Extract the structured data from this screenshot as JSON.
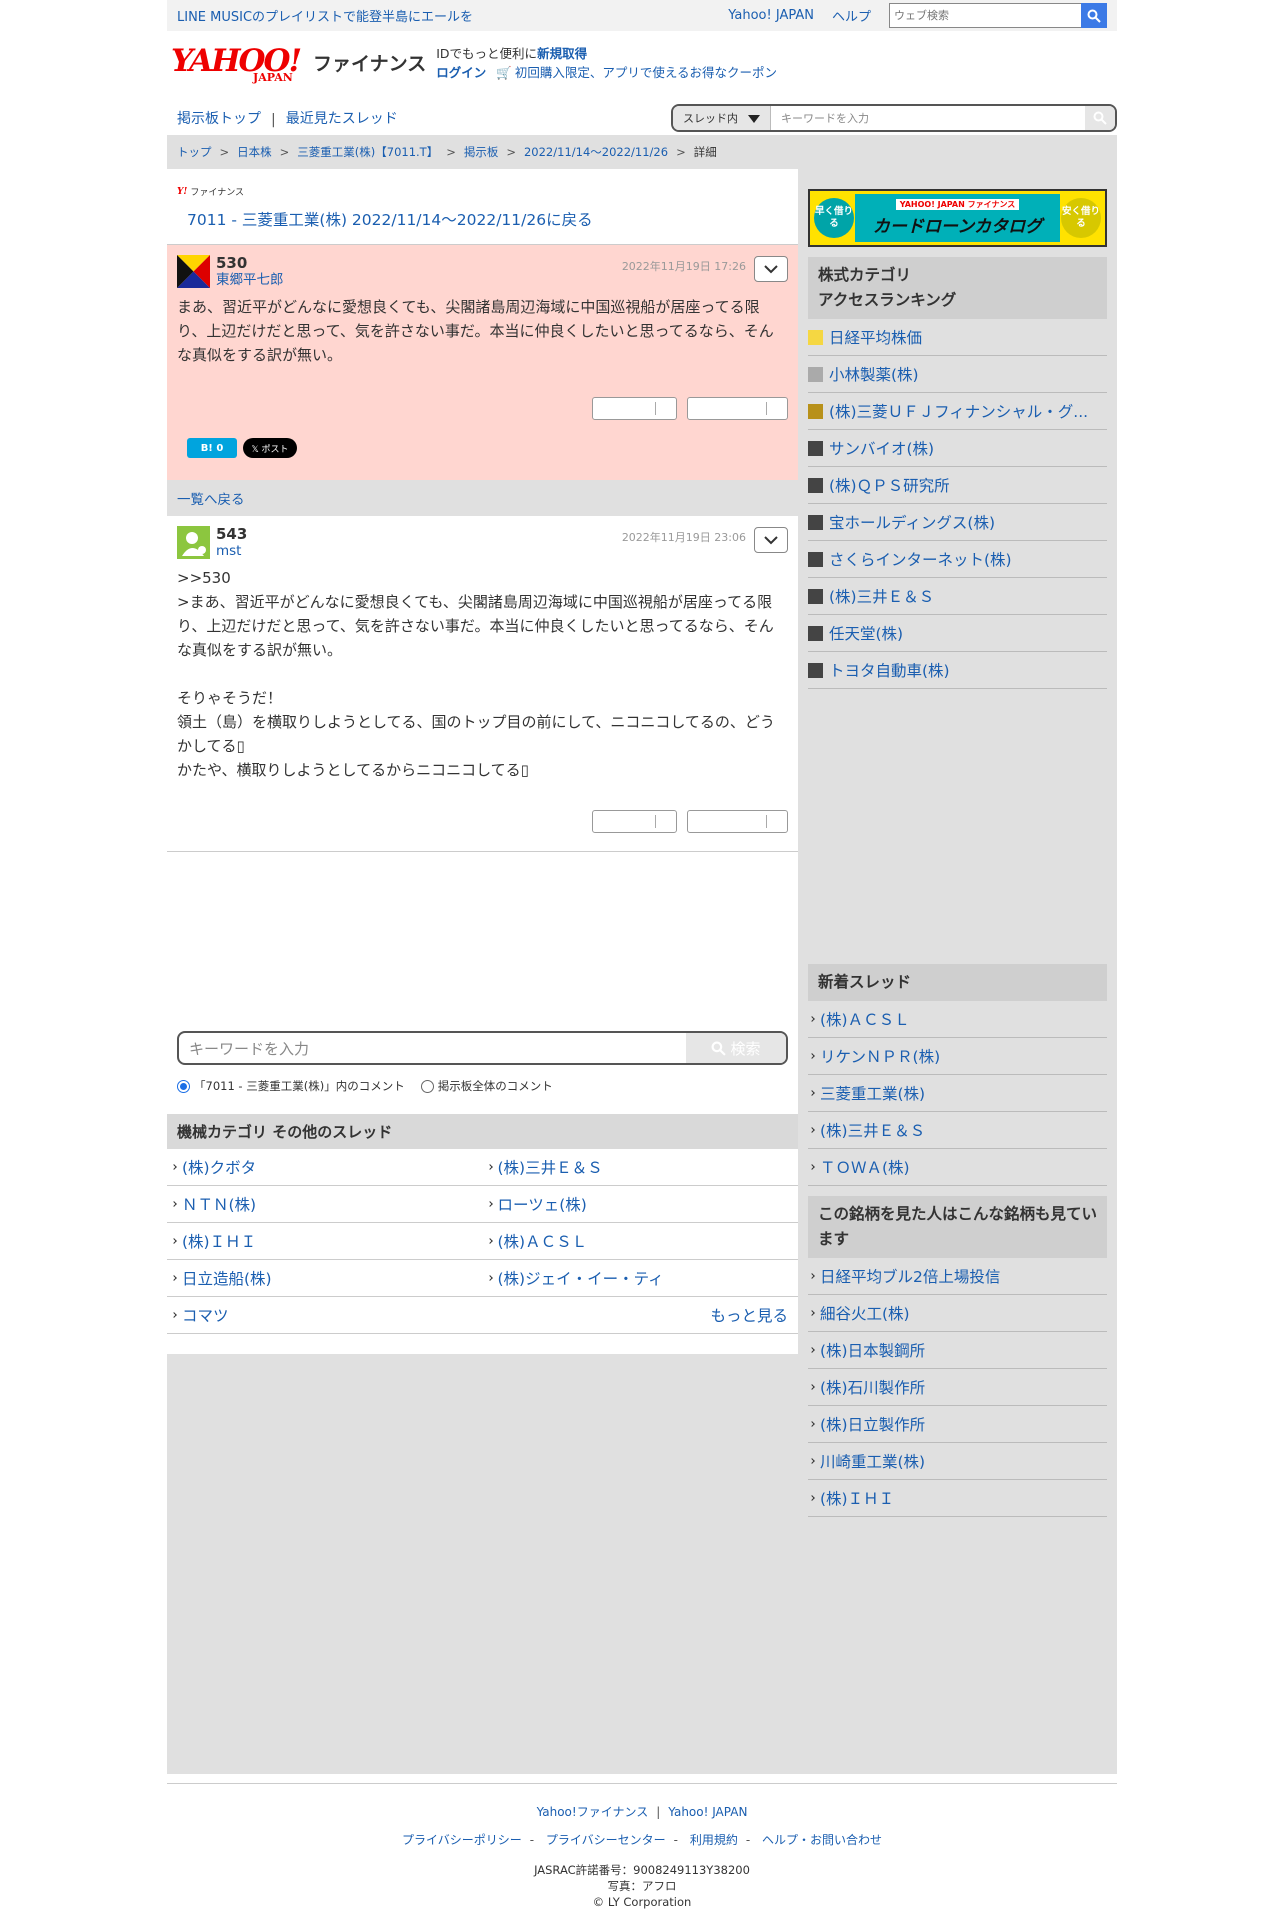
{
  "topbar": {
    "promo": "LINE MUSICのプレイリストで能登半島にエールを",
    "yahoo_japan": "Yahoo! JAPAN",
    "help": "ヘルプ",
    "web_search_placeholder": "ウェブ検索"
  },
  "header": {
    "logo_yahoo": "YAHOO!",
    "logo_japan": "JAPAN",
    "logo_finance": "ファイナンス",
    "id_msg": "IDでもっと便利に",
    "signup": "新規取得",
    "login": "ログイン",
    "coupon": "初回購入限定、アプリで使えるお得なクーポン"
  },
  "nav": {
    "board_top": "掲示板トップ",
    "separator": "|",
    "recent_threads": "最近見たスレッド",
    "scope": "スレッド内",
    "keyword_placeholder": "キーワードを入力"
  },
  "breadcrumb": {
    "items": [
      "トップ",
      "日本株",
      "三菱重工業(株)【7011.T】",
      "掲示板",
      "2022/11/14〜2022/11/26",
      "詳細"
    ],
    "separator": ">"
  },
  "thread": {
    "brand": "ファイナンス",
    "back_title": "7011 - 三菱重工業(株) 2022/11/14〜2022/11/26に戻る"
  },
  "posts": [
    {
      "number": "530",
      "user": "東郷平七郎",
      "date": "2022年11月19日 17:26",
      "body": "まあ、習近平がどんなに愛想良くても、尖閣諸島周辺海域に中国巡視船が居座ってる限り、上辺だけだと思って、気を許さない事だ。本当に仲良くしたいと思ってるなら、そんな真似をする訳が無い。"
    },
    {
      "number": "543",
      "user": "mst",
      "date": "2022年11月19日 23:06",
      "body": ">>530\n>まあ、習近平がどんなに愛想良くても、尖閣諸島周辺海域に中国巡視船が居座ってる限り、上辺だけだと思って、気を許さない事だ。本当に仲良くしたいと思ってるなら、そんな真似をする訳が無い。\n\nそりゃそうだ！\n領土（島）を横取りしようとしてる、国のトップ目の前にして、ニコニコしてるの、どうかしてる▯\nかたや、横取りしようとしてるからニコニコしてる▯"
    }
  ],
  "social": {
    "hatena": "B! 0",
    "x_post": "𝕏 ポスト"
  },
  "back_to_list": "一覧へ戻る",
  "keyword_search": {
    "placeholder": "キーワードを入力",
    "button": "検索",
    "radio_in_thread": "「7011 - 三菱重工業(株)」内のコメント",
    "radio_all": "掲示板全体のコメント"
  },
  "category": {
    "title": "機械カテゴリ  その他のスレッド",
    "items": [
      "(株)クボタ",
      "(株)三井Ｅ＆Ｓ",
      "ＮＴＮ(株)",
      "ローツェ(株)",
      "(株)ＩＨＩ",
      "(株)ＡＣＳＬ",
      "日立造船(株)",
      "(株)ジェイ・イー・ティ",
      "コマツ"
    ],
    "more": "もっと見る"
  },
  "ad": {
    "left": "早く借りる",
    "brand": "YAHOO! JAPAN ファイナンス",
    "title": "カードローンカタログ",
    "right": "安く借りる"
  },
  "ranking": {
    "title": "株式カテゴリ\nアクセスランキング",
    "items": [
      {
        "name": "日経平均株価",
        "color": "#f5d742"
      },
      {
        "name": "小林製薬(株)",
        "color": "#aaaaaa"
      },
      {
        "name": "(株)三菱ＵＦＪフィナンシャル・グ...",
        "color": "#b8911a"
      },
      {
        "name": "サンバイオ(株)",
        "color": "#444444"
      },
      {
        "name": "(株)ＱＰＳ研究所",
        "color": "#444444"
      },
      {
        "name": "宝ホールディングス(株)",
        "color": "#444444"
      },
      {
        "name": "さくらインターネット(株)",
        "color": "#444444"
      },
      {
        "name": "(株)三井Ｅ＆Ｓ",
        "color": "#444444"
      },
      {
        "name": "任天堂(株)",
        "color": "#444444"
      },
      {
        "name": "トヨタ自動車(株)",
        "color": "#444444"
      }
    ]
  },
  "new_threads": {
    "title": "新着スレッド",
    "items": [
      "(株)ＡＣＳＬ",
      "リケンＮＰＲ(株)",
      "三菱重工業(株)",
      "(株)三井Ｅ＆Ｓ",
      "ＴＯＷＡ(株)"
    ]
  },
  "also_viewed": {
    "title": "この銘柄を見た人はこんな銘柄も見ています",
    "items": [
      "日経平均ブル2倍上場投信",
      "細谷火工(株)",
      "(株)日本製鋼所",
      "(株)石川製作所",
      "(株)日立製作所",
      "川崎重工業(株)",
      "(株)ＩＨＩ"
    ]
  },
  "footer": {
    "finance": "Yahoo!ファイナンス",
    "sep": "|",
    "yahoo_japan": "Yahoo! JAPAN",
    "privacy_policy": "プライバシーポリシー",
    "privacy_center": "プライバシーセンター",
    "terms": "利用規約",
    "help": "ヘルプ・お問い合わせ",
    "dash": "-",
    "jasrac": "JASRAC許諾番号：9008249113Y38200",
    "photo": "写真：アフロ",
    "copyright": "© LY Corporation"
  }
}
